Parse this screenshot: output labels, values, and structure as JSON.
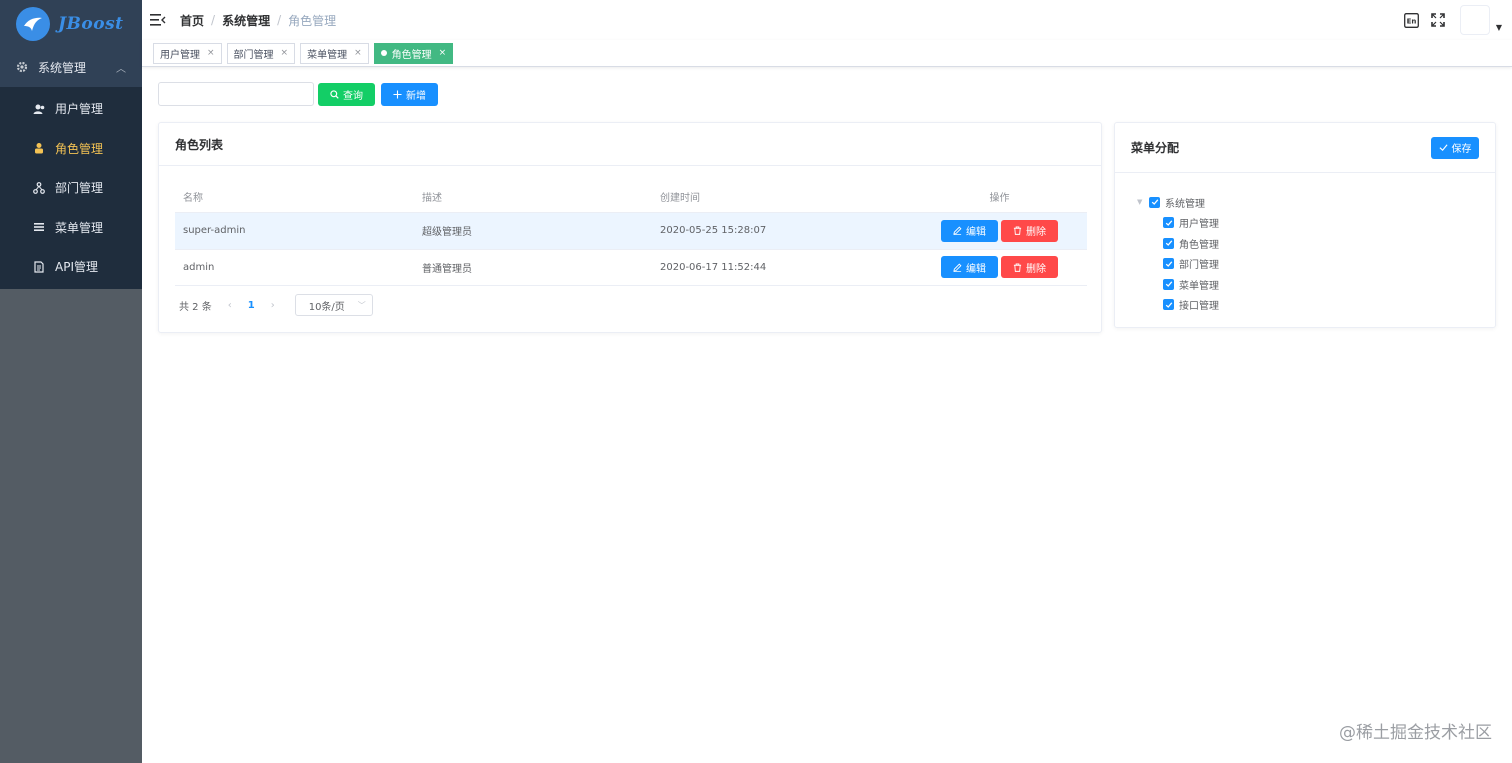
{
  "logo": {
    "text": "JBoost"
  },
  "sidebar": {
    "parent": {
      "label": "系统管理"
    },
    "items": [
      {
        "label": "用户管理",
        "icon": "user-icon"
      },
      {
        "label": "角色管理",
        "icon": "role-icon",
        "active": true
      },
      {
        "label": "部门管理",
        "icon": "sitemap-icon"
      },
      {
        "label": "菜单管理",
        "icon": "menu-list-icon"
      },
      {
        "label": "API管理",
        "icon": "document-icon"
      }
    ]
  },
  "breadcrumb": {
    "home": "首页",
    "section": "系统管理",
    "current": "角色管理"
  },
  "tags": [
    {
      "label": "用户管理"
    },
    {
      "label": "部门管理"
    },
    {
      "label": "菜单管理"
    },
    {
      "label": "角色管理",
      "active": true
    }
  ],
  "toolbar": {
    "search_placeholder": "",
    "query_label": "查询",
    "add_label": "新增"
  },
  "roles": {
    "title": "角色列表",
    "columns": [
      "名称",
      "描述",
      "创建时间",
      "操作"
    ],
    "rows": [
      {
        "name": "super-admin",
        "desc": "超级管理员",
        "created": "2020-05-25 15:28:07"
      },
      {
        "name": "admin",
        "desc": "普通管理员",
        "created": "2020-06-17 11:52:44"
      }
    ],
    "edit_label": "编辑",
    "delete_label": "删除",
    "pager": {
      "total": "共 2 条",
      "page": "1",
      "size": "10条/页"
    }
  },
  "menu_assign": {
    "title": "菜单分配",
    "save_label": "保存",
    "root": "系统管理",
    "children": [
      "用户管理",
      "角色管理",
      "部门管理",
      "菜单管理",
      "接口管理"
    ]
  },
  "watermark": "@稀土掘金技术社区",
  "colors": {
    "primary": "#1890ff",
    "success": "#13ce66",
    "danger": "#ff4949",
    "tag_active": "#42b983",
    "sidebar": "#304156"
  }
}
